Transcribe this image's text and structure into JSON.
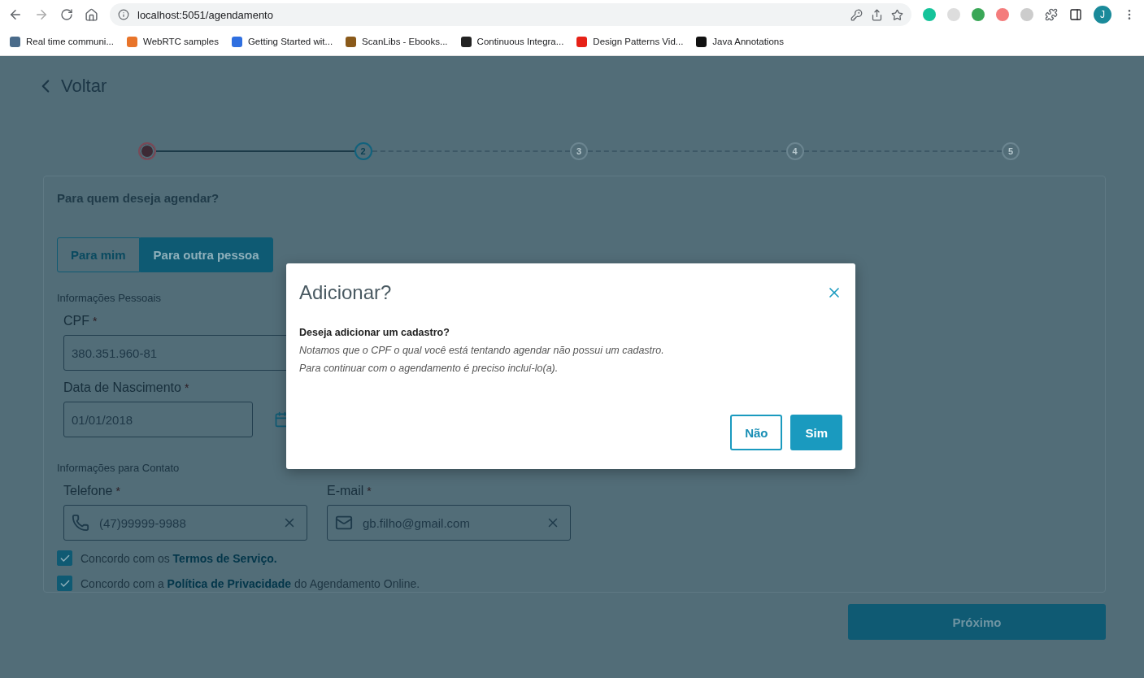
{
  "browser": {
    "url": "localhost:5051/agendamento",
    "profile_initial": "J",
    "bookmarks": [
      {
        "label": "Real time communi...",
        "color": "#4a6b8a"
      },
      {
        "label": "WebRTC samples",
        "color": "#e8742a"
      },
      {
        "label": "Getting Started wit...",
        "color": "#2f6fe0"
      },
      {
        "label": "ScanLibs - Ebooks...",
        "color": "#8a5a1a"
      },
      {
        "label": "Continuous Integra...",
        "color": "#222222"
      },
      {
        "label": "Design Patterns Vid...",
        "color": "#e62117"
      },
      {
        "label": "Java Annotations",
        "color": "#111111"
      }
    ]
  },
  "page": {
    "back_label": "Voltar",
    "steps": [
      {
        "kind": "done"
      },
      {
        "label": "2",
        "kind": "current"
      },
      {
        "label": "3",
        "kind": "pending"
      },
      {
        "label": "4",
        "kind": "pending"
      },
      {
        "label": "5",
        "kind": "pending"
      }
    ],
    "question": "Para quem deseja agendar?",
    "tabs": [
      {
        "label": "Para mim",
        "selected": false
      },
      {
        "label": "Para outra pessoa",
        "selected": true
      }
    ],
    "personal_title": "Informações Pessoais",
    "cpf": {
      "label": "CPF",
      "required_mark": "*",
      "value": "380.351.960-81"
    },
    "birth_date": {
      "label": "Data de Nascimento",
      "required_mark": "*",
      "value": "01/01/2018"
    },
    "contact_title": "Informações para Contato",
    "phone": {
      "label": "Telefone",
      "required_mark": "*",
      "value": "(47)99999-9988"
    },
    "email": {
      "label": "E-mail",
      "required_mark": "*",
      "value": "gb.filho@gmail.com"
    },
    "agreements": [
      {
        "checked": true,
        "before": "Concordo com os ",
        "link": "Termos de Serviço."
      },
      {
        "checked": true,
        "before": "Concordo com a ",
        "link": "Política de Privacidade",
        "after": " do Agendamento Online."
      }
    ],
    "next_button": "Próximo"
  },
  "modal": {
    "title": "Adicionar?",
    "heading": "Deseja adicionar um cadastro?",
    "lines": [
      "Notamos que o CPF o qual você está tentando agendar não possui um cadastro.",
      "Para continuar com o agendamento é preciso incluí-lo(a)."
    ],
    "buttons": [
      {
        "label": "Não",
        "kind": "outline"
      },
      {
        "label": "Sim",
        "kind": "primary"
      }
    ]
  }
}
